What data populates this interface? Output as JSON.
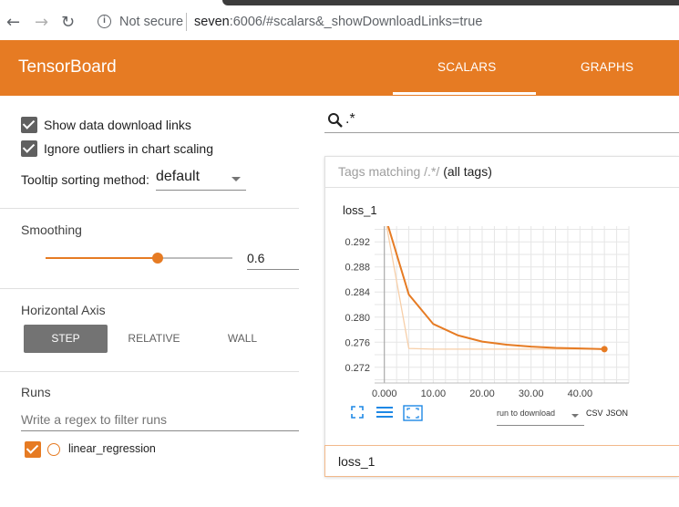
{
  "browser": {
    "not_secure": "Not secure",
    "url_host": "seven",
    "url_rest": ":6006/#scalars&_showDownloadLinks=true",
    "icons": [
      "back-arrow-icon",
      "forward-arrow-icon",
      "reload-icon",
      "info-icon"
    ]
  },
  "header": {
    "brand": "TensorBoard",
    "tabs": [
      {
        "label": "SCALARS",
        "active": true
      },
      {
        "label": "GRAPHS",
        "active": false
      }
    ],
    "color": "#e67b23"
  },
  "sidebar": {
    "show_download_links": {
      "label": "Show data download links",
      "checked": true
    },
    "ignore_outliers": {
      "label": "Ignore outliers in chart scaling",
      "checked": true
    },
    "tooltip_sorting": {
      "label": "Tooltip sorting method:",
      "value": "default"
    },
    "smoothing": {
      "title": "Smoothing",
      "value": "0.6",
      "fraction": 0.6
    },
    "horizontal_axis": {
      "title": "Horizontal Axis",
      "options": [
        "STEP",
        "RELATIVE",
        "WALL"
      ],
      "selected": "STEP"
    },
    "runs": {
      "title": "Runs",
      "filter_placeholder": "Write a regex to filter runs",
      "items": [
        {
          "label": "linear_regression",
          "checked": true,
          "color": "#e67b23"
        }
      ]
    }
  },
  "main": {
    "search_value": ".*",
    "tags_prefix": "Tags matching ",
    "tags_regex": "/.*/",
    "tags_suffix": "(all tags)",
    "chart_card_title": "loss_1",
    "run_select": "run to download",
    "download_links": [
      "CSV",
      "JSON"
    ],
    "bottom_card_title": "loss_1"
  },
  "chart_data": {
    "type": "line",
    "title": "loss_1",
    "xlabel": "",
    "ylabel": "",
    "x_ticks": [
      "0.000",
      "10.00",
      "20.00",
      "30.00",
      "40.00"
    ],
    "y_ticks": [
      "0.272",
      "0.276",
      "0.280",
      "0.284",
      "0.288",
      "0.292"
    ],
    "xlim": [
      -2,
      50
    ],
    "ylim": [
      0.2695,
      0.2945
    ],
    "grid": true,
    "series": [
      {
        "smoothed": true,
        "color": "#e67b23",
        "x": [
          0,
          5,
          10,
          15,
          20,
          25,
          30,
          35,
          40,
          45
        ],
        "values": [
          0.2965,
          0.2836,
          0.2789,
          0.2771,
          0.2761,
          0.2756,
          0.2753,
          0.2751,
          0.275,
          0.2749
        ]
      },
      {
        "smoothed": false,
        "color": "#f7cfa9",
        "x": [
          0,
          5,
          10,
          15,
          20,
          25,
          30,
          35,
          40,
          45
        ],
        "values": [
          0.2965,
          0.275,
          0.2749,
          0.2749,
          0.2749,
          0.2749,
          0.2749,
          0.2749,
          0.2749,
          0.2749
        ]
      }
    ]
  }
}
